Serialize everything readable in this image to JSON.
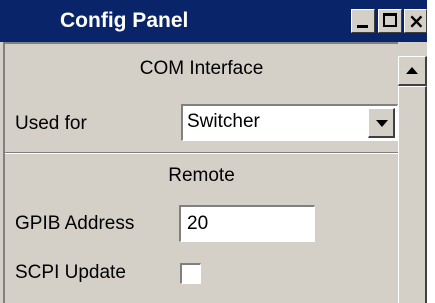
{
  "window": {
    "title": "Config Panel",
    "controls": [
      "minimize-icon",
      "maximize-icon",
      "close-icon"
    ],
    "title_bar_color": "#0a246a",
    "close_glyph": "×"
  },
  "com_interface": {
    "heading": "COM Interface",
    "used_for_label": "Used for",
    "used_for_value": "Switcher"
  },
  "remote": {
    "heading": "Remote",
    "gpib_address_label": "GPIB Address",
    "gpib_address_value": "20",
    "scpi_update_label": "SCPI Update",
    "scpi_update_checked": false
  }
}
